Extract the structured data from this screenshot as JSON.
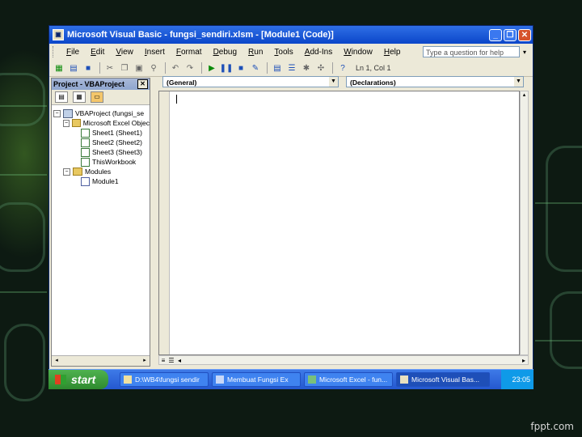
{
  "window": {
    "title": "Microsoft Visual Basic - fungsi_sendiri.xlsm - [Module1 (Code)]",
    "minimize": "_",
    "restore": "❐",
    "close": "✕"
  },
  "menubar": {
    "items": [
      "File",
      "Edit",
      "View",
      "Insert",
      "Format",
      "Debug",
      "Run",
      "Tools",
      "Add-Ins",
      "Window",
      "Help"
    ],
    "help_placeholder": "Type a question for help"
  },
  "toolbar": {
    "position": "Ln 1, Col 1"
  },
  "project_pane": {
    "title": "Project - VBAProject",
    "tree": {
      "root": "VBAProject (fungsi_se",
      "excel_objects": "Microsoft Excel Objec",
      "sheets": [
        "Sheet1 (Sheet1)",
        "Sheet2 (Sheet2)",
        "Sheet3 (Sheet3)"
      ],
      "workbook": "ThisWorkbook",
      "modules_folder": "Modules",
      "module": "Module1"
    }
  },
  "code_window": {
    "object_combo": "(General)",
    "procedure_combo": "(Declarations)"
  },
  "taskbar": {
    "start_label": "start",
    "tasks": [
      {
        "label": "D:\\WB4\\fungsi sendir"
      },
      {
        "label": "Membuat Fungsi Ex"
      },
      {
        "label": "Microsoft Excel - fun..."
      },
      {
        "label": "Microsoft Visual Bas..."
      }
    ],
    "clock": "23:05"
  },
  "watermark": "fppt.com"
}
